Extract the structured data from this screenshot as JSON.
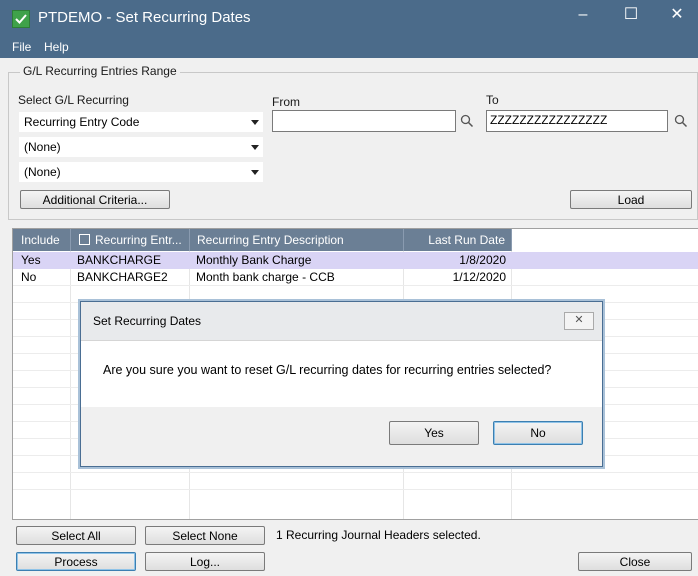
{
  "window": {
    "title": "PTDEMO - Set Recurring Dates",
    "minimize_glyph": "–",
    "maximize_glyph": "☐",
    "close_glyph": "✕"
  },
  "menu": {
    "file": "File",
    "help": "Help"
  },
  "range_group": {
    "title": "G/L Recurring Entries Range",
    "select_label": "Select G/L Recurring",
    "from_label": "From",
    "to_label": "To",
    "combo1": "Recurring Entry Code",
    "combo2": "(None)",
    "combo3": "(None)",
    "from_value": "",
    "to_value": "ZZZZZZZZZZZZZZZZ",
    "additional_criteria": "Additional Criteria...",
    "load": "Load"
  },
  "table": {
    "columns": [
      "Include",
      "Recurring Entr...",
      "Recurring Entry Description",
      "Last Run Date"
    ],
    "rows": [
      {
        "include": "Yes",
        "code": "BANKCHARGE",
        "description": "Monthly Bank Charge",
        "last_run": "1/8/2020"
      },
      {
        "include": "No",
        "code": "BANKCHARGE2",
        "description": "Month bank charge - CCB",
        "last_run": "1/12/2020"
      }
    ]
  },
  "footer": {
    "select_all": "Select All",
    "select_none": "Select None",
    "status": "1 Recurring Journal Headers selected.",
    "process": "Process",
    "log": "Log...",
    "close": "Close"
  },
  "dialog": {
    "title": "Set Recurring Dates",
    "message": "Are you sure you want to reset G/L recurring dates for recurring entries selected?",
    "yes": "Yes",
    "no": "No",
    "close_glyph": "✕"
  },
  "colors": {
    "titlebar": "#4b6b8a",
    "header": "#6b7f95",
    "selected_row": "#d9d4f5",
    "app_icon": "#3fa24a"
  }
}
